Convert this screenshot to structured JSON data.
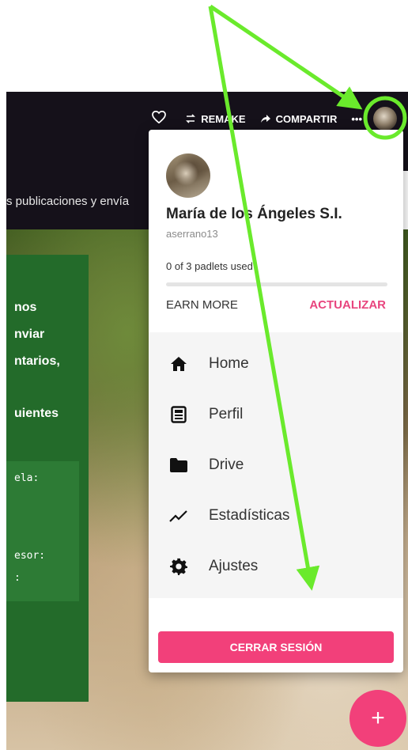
{
  "topbar": {
    "remake_label": "REMAKE",
    "share_label": "COMPARTIR",
    "more_label": "•••"
  },
  "background": {
    "subtitle": "s publicaciones y envía"
  },
  "green_card": {
    "lines": [
      "nos",
      "nviar",
      "ntarios,",
      "",
      "uientes"
    ],
    "mono_lines": [
      "ela:",
      "",
      "esor:",
      ":"
    ]
  },
  "menu": {
    "name": "María de los Ángeles S.I.",
    "username": "aserrano13",
    "usage": "0 of 3 padlets used",
    "usage_fraction": 0.0,
    "earn_more": "EARN MORE",
    "upgrade": "ACTUALIZAR",
    "items": [
      {
        "label": "Home",
        "icon": "home-icon"
      },
      {
        "label": "Perfil",
        "icon": "profile-card-icon"
      },
      {
        "label": "Drive",
        "icon": "folder-icon"
      },
      {
        "label": "Estadísticas",
        "icon": "trending-icon"
      },
      {
        "label": "Ajustes",
        "icon": "gear-icon"
      }
    ],
    "logout": "CERRAR SESIÓN"
  },
  "fab": {
    "label": "+"
  },
  "colors": {
    "accent_pink": "#f2407a",
    "annotation_green": "#6aea2c",
    "topbar_bg": "#15111a",
    "card_green": "#236b2a"
  }
}
